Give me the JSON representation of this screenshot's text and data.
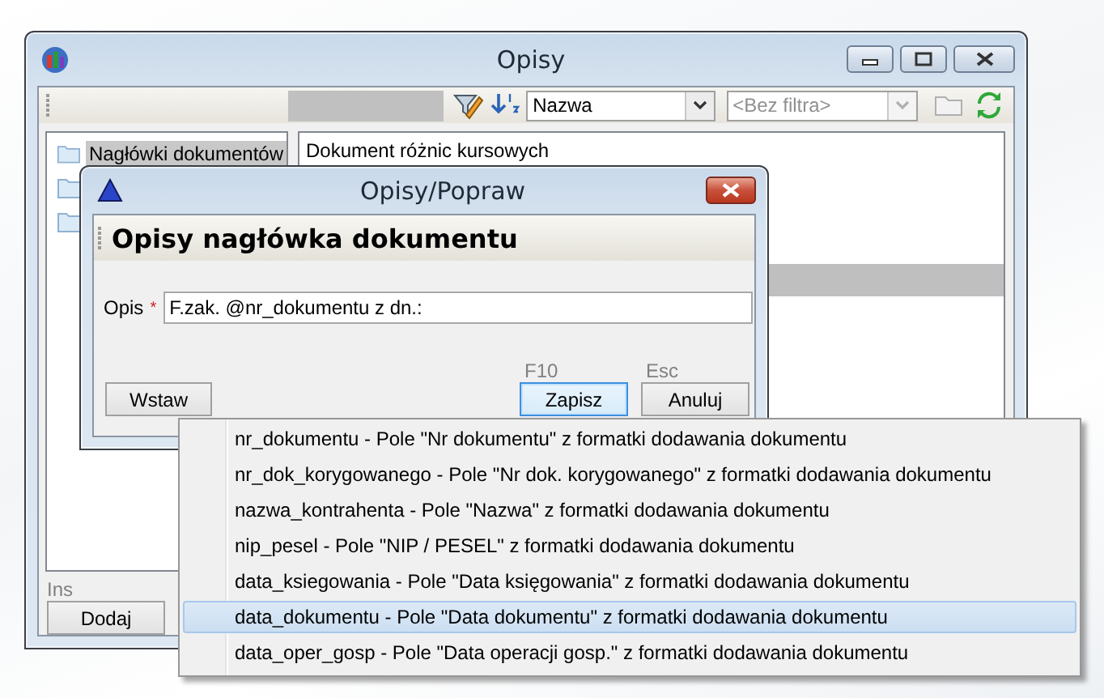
{
  "main_window": {
    "title": "Opisy"
  },
  "toolbar": {
    "sort_field": "Nazwa",
    "filter": {
      "placeholder": "<Bez filtra>",
      "disabled": true
    }
  },
  "tree": [
    {
      "label": "Nagłówki dokumentów",
      "selected": true
    },
    {
      "selected": false
    },
    {
      "selected": false
    }
  ],
  "list": [
    {
      "text": "Dokument różnic kursowych",
      "selected": false
    },
    {
      "selected": false
    },
    {
      "selected": false
    },
    {
      "selected": false
    },
    {
      "selected": true
    }
  ],
  "bottom": {
    "shortcut": "Ins",
    "button": "Dodaj"
  },
  "dialog": {
    "title": "Opisy/Popraw",
    "heading": "Opisy nagłówka dokumentu",
    "field_label": "Opis",
    "required_mark": "*",
    "field_value": "F.zak. @nr_dokumentu z dn.:",
    "buttons": [
      {
        "label": "Wstaw",
        "focused": false
      },
      {
        "label": "Zapisz",
        "shortcut": "F10",
        "focused": true
      },
      {
        "label": "Anuluj",
        "shortcut": "Esc",
        "focused": false
      }
    ]
  },
  "menu": [
    {
      "label": "nr_dokumentu - Pole \"Nr dokumentu\" z formatki dodawania dokumentu",
      "selected": false
    },
    {
      "label": "nr_dok_korygowanego - Pole \"Nr dok. korygowanego\" z formatki dodawania dokumentu",
      "selected": false
    },
    {
      "label": "nazwa_kontrahenta - Pole \"Nazwa\" z formatki dodawania dokumentu",
      "selected": false
    },
    {
      "label": "nip_pesel - Pole \"NIP / PESEL\" z formatki dodawania dokumentu",
      "selected": false
    },
    {
      "label": "data_ksiegowania - Pole \"Data księgowania\" z formatki dodawania dokumentu",
      "selected": false
    },
    {
      "label": "data_dokumentu - Pole \"Data dokumentu\" z formatki dodawania dokumentu",
      "selected": true
    },
    {
      "label": "data_oper_gosp - Pole \"Data operacji gosp.\" z formatki dodawania dokumentu",
      "selected": false
    }
  ]
}
